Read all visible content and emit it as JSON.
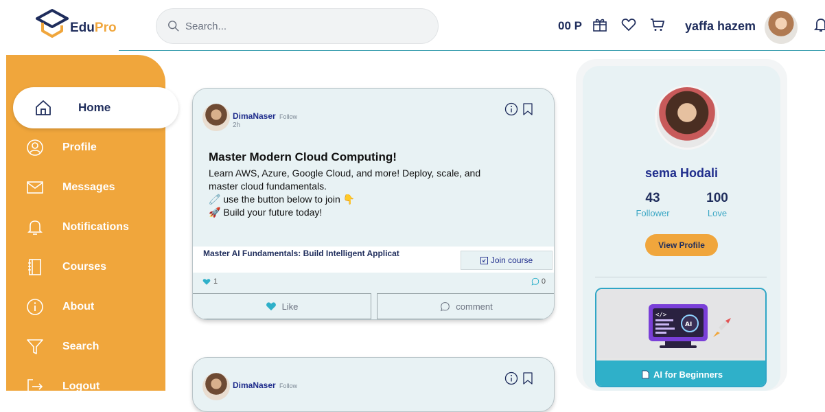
{
  "header": {
    "logo_edu": "Edu",
    "logo_pro": "Pro",
    "search_placeholder": "Search...",
    "points": "00 P",
    "icons": [
      "gift-icon",
      "heart-icon",
      "cart-icon",
      "bell-icon"
    ],
    "username": "yaffa hazem"
  },
  "sidebar": {
    "items": [
      {
        "label": "Home",
        "icon": "home-icon",
        "active": true
      },
      {
        "label": "Profile",
        "icon": "profile-icon"
      },
      {
        "label": "Messages",
        "icon": "mail-icon"
      },
      {
        "label": "Notifications",
        "icon": "bell-icon"
      },
      {
        "label": "Courses",
        "icon": "book-icon"
      },
      {
        "label": "About",
        "icon": "info-icon"
      },
      {
        "label": "Search",
        "icon": "filter-icon"
      },
      {
        "label": "Logout",
        "icon": "logout-icon"
      }
    ]
  },
  "posts": [
    {
      "author": "DimaNaser",
      "follow": "Follow",
      "time": "2h",
      "title": "Master Modern Cloud Computing!",
      "body_line1": "Learn AWS, Azure, Google Cloud, and more! Deploy, scale, and",
      "body_line2": "master cloud fundamentals.",
      "body_line3": "🧷 use the button below to join 👇",
      "body_line4": "🚀 Build your future today!",
      "course_title": "Master AI Fundamentals: Build Intelligent Applicat",
      "join_label": "Join course",
      "likes": "1",
      "comments": "0",
      "like_label": "Like",
      "comment_label": "comment"
    },
    {
      "author": "DimaNaser",
      "follow": "Follow"
    }
  ],
  "profile_card": {
    "name": "sema Hodali",
    "followers": "43",
    "followers_label": "Follower",
    "love": "100",
    "love_label": "Love",
    "view_profile": "View Profile",
    "course_label": "AI for Beginners"
  },
  "colors": {
    "brand_navy": "#1f2d5c",
    "brand_orange": "#f0a63c",
    "accent_teal": "#2fb0c9",
    "card_bg": "#e8f2f4"
  }
}
